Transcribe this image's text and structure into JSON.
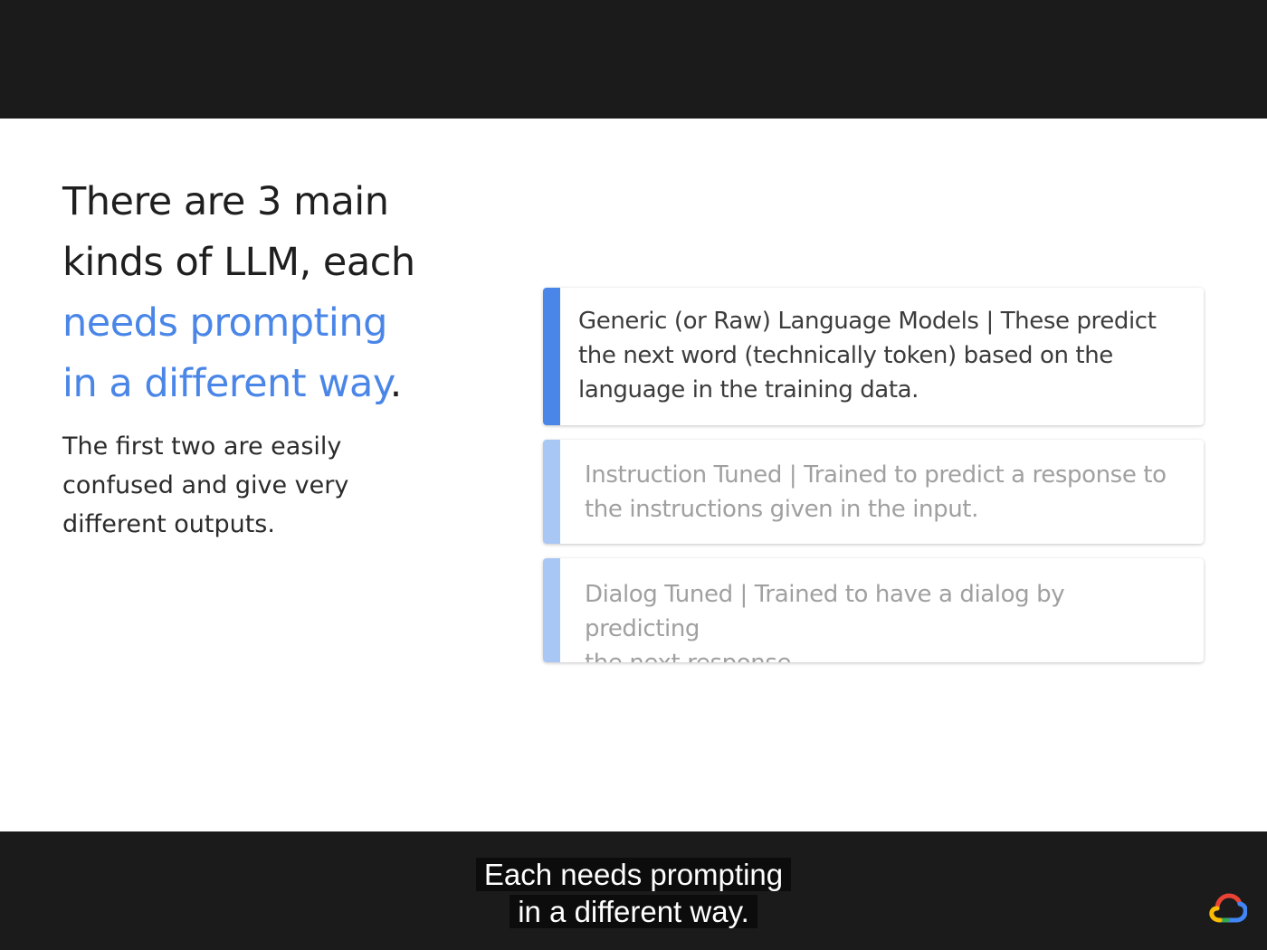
{
  "slide": {
    "heading": {
      "line1": "There are 3 main",
      "line2": "kinds of LLM, each",
      "line3": "needs prompting",
      "line4": "in a different way",
      "period": "."
    },
    "subtext": {
      "line1": "The first two are easily",
      "line2": "confused and give very",
      "line3": "different outputs."
    },
    "cards": [
      {
        "title": "Generic (or Raw) Language Models",
        "separator": " | ",
        "description_line1": "These predict",
        "description_line2": "the next word (technically token) based on the",
        "description_line3": "language in the training data.",
        "accent_color": "#4a86e8"
      },
      {
        "title": "Instruction Tuned",
        "separator": " | ",
        "description_line1": "Trained to predict a response to",
        "description_line2": "the instructions given in the input.",
        "accent_color": "#a9c7f5"
      },
      {
        "title": "Dialog Tuned",
        "separator": " | ",
        "description_line1": "Trained to have a dialog by predicting",
        "description_line2": "the next response.",
        "accent_color": "#a9c7f5"
      }
    ]
  },
  "caption": {
    "line1": "Each needs prompting",
    "line2": "in a different way."
  },
  "logo": {
    "icon": "google-cloud-logo-icon",
    "colors": [
      "#ea4335",
      "#4285f4",
      "#34a853",
      "#fbbc05"
    ]
  }
}
